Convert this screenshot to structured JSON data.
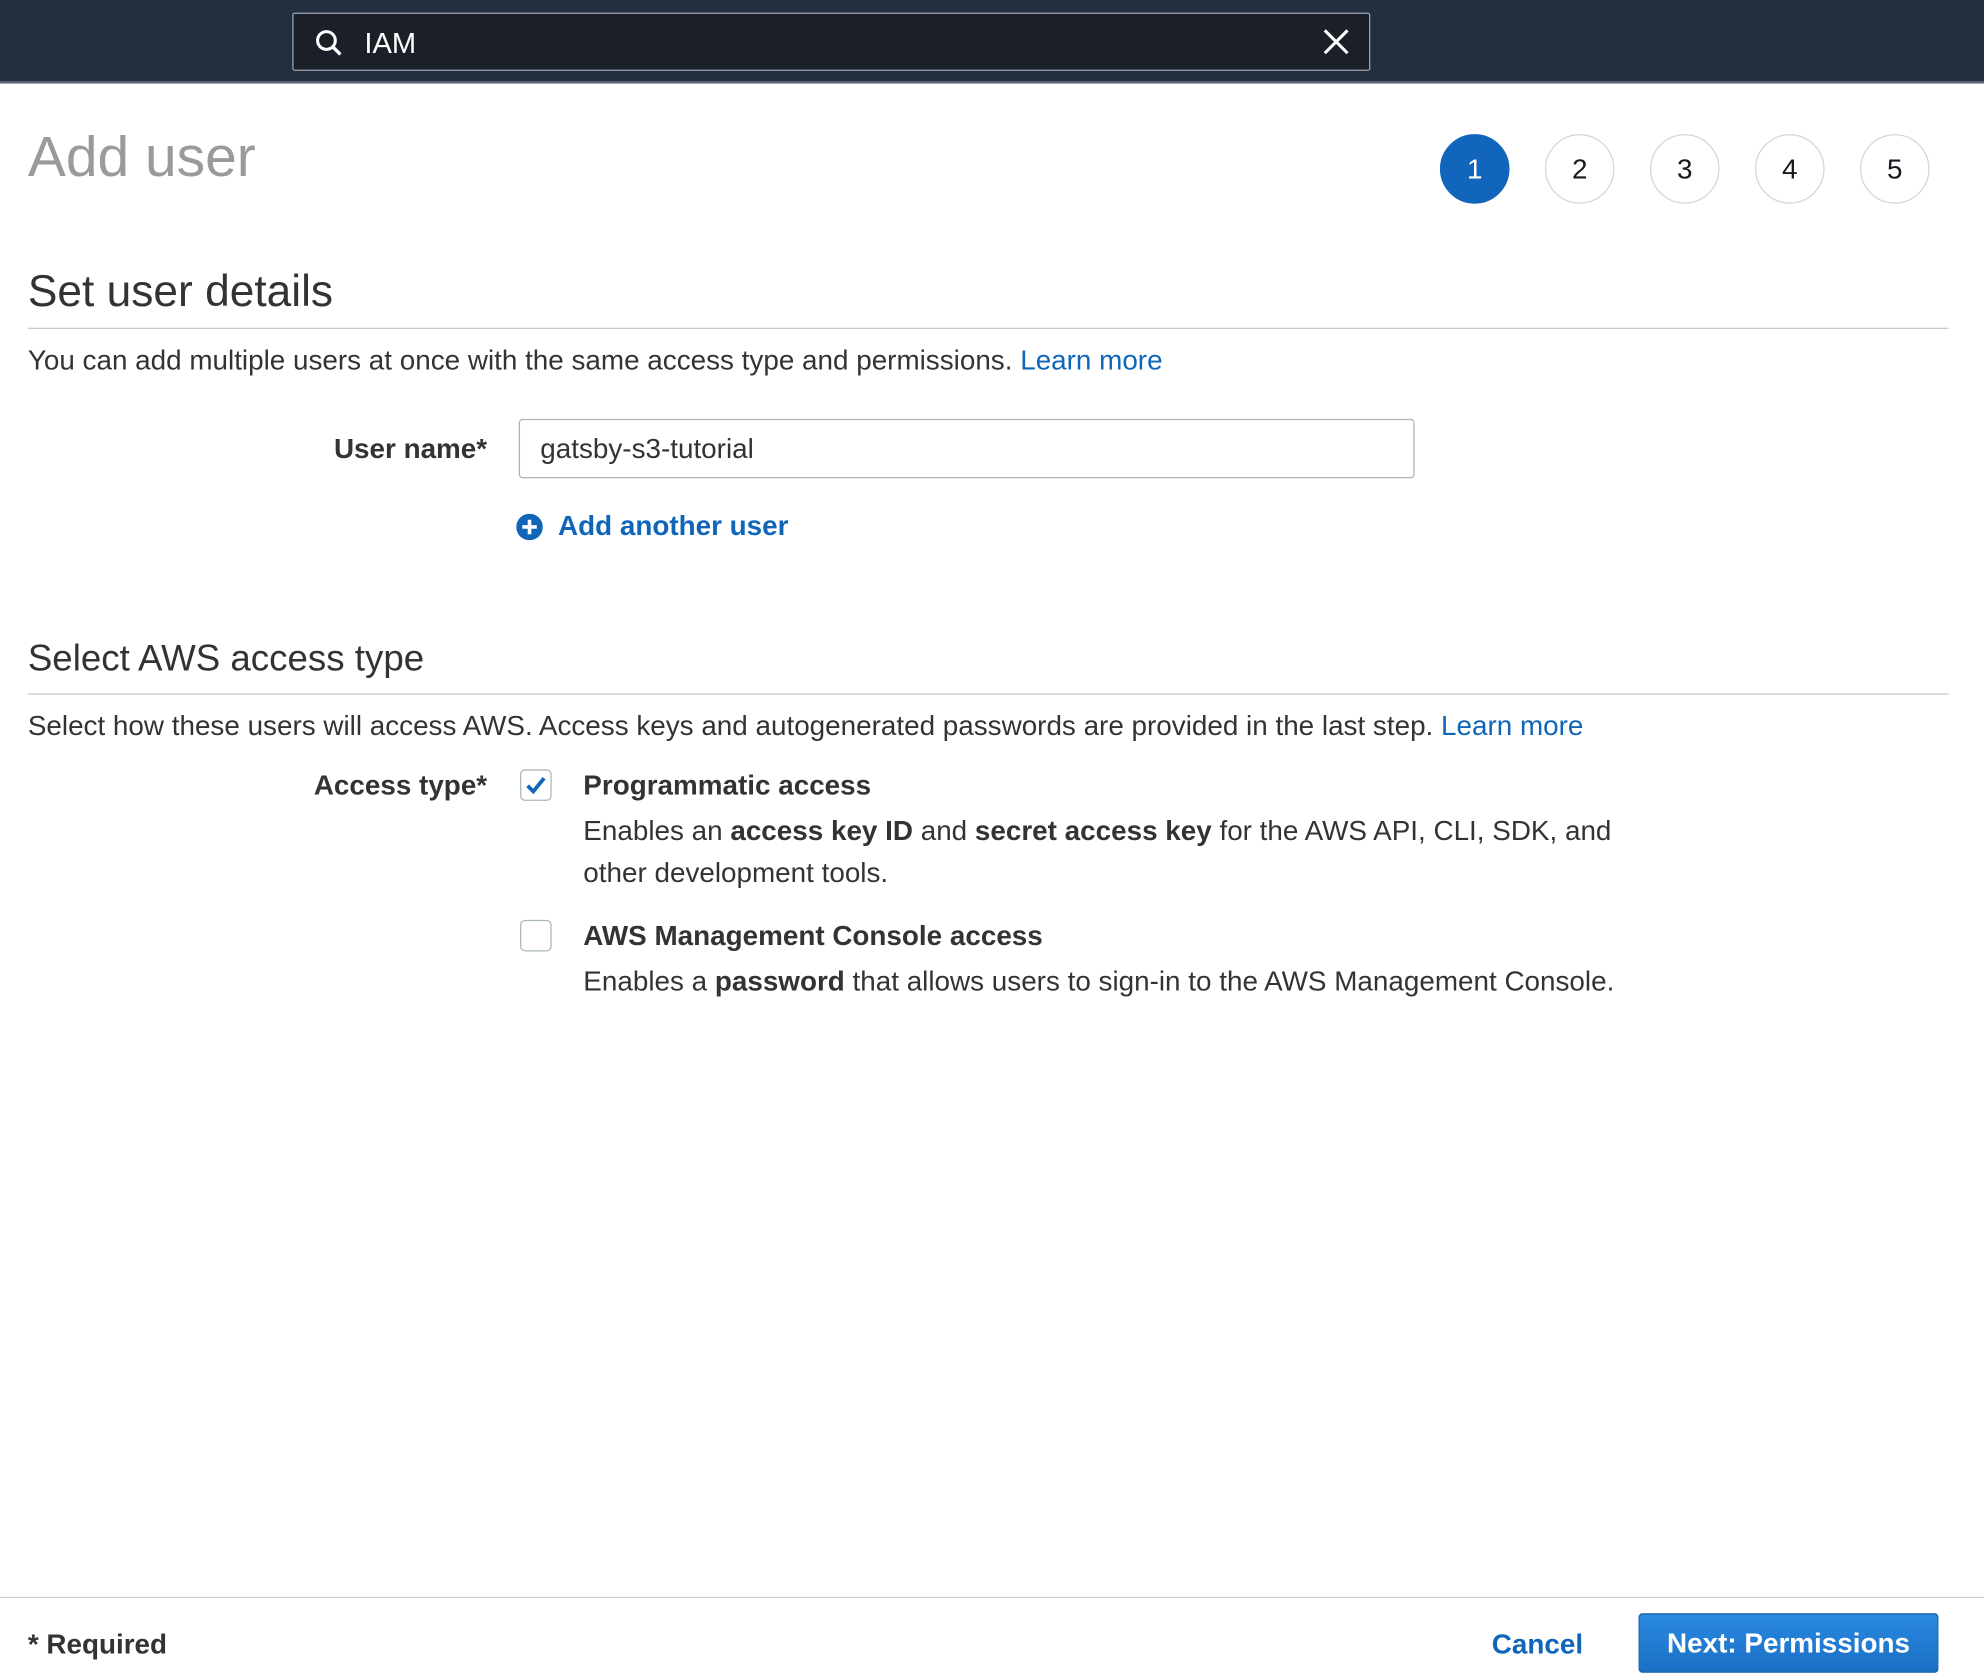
{
  "search": {
    "value": "IAM"
  },
  "page_title": "Add user",
  "steps": [
    "1",
    "2",
    "3",
    "4",
    "5"
  ],
  "active_step": 1,
  "user_details": {
    "heading": "Set user details",
    "description": "You can add multiple users at once with the same access type and permissions.",
    "learn_more": "Learn more",
    "user_name_label": "User name*",
    "user_name_value": "gatsby-s3-tutorial",
    "add_another_user": "Add another user"
  },
  "access_type": {
    "heading": "Select AWS access type",
    "description": "Select how these users will access AWS. Access keys and autogenerated passwords are provided in the last step.",
    "learn_more": "Learn more",
    "label": "Access type*",
    "options": [
      {
        "title": "Programmatic access",
        "checked": true,
        "desc_parts": [
          "Enables an ",
          "access key ID",
          " and ",
          "secret access key",
          " for the AWS API, CLI, SDK, and other development tools."
        ]
      },
      {
        "title": "AWS Management Console access",
        "checked": false,
        "desc_parts": [
          "Enables a ",
          "password",
          " that allows users to sign-in to the AWS Management Console."
        ]
      }
    ]
  },
  "footer": {
    "required_note": "* Required",
    "cancel": "Cancel",
    "next": "Next: Permissions"
  },
  "colors": {
    "accent": "#1166bb",
    "topbar": "#232f3e"
  }
}
